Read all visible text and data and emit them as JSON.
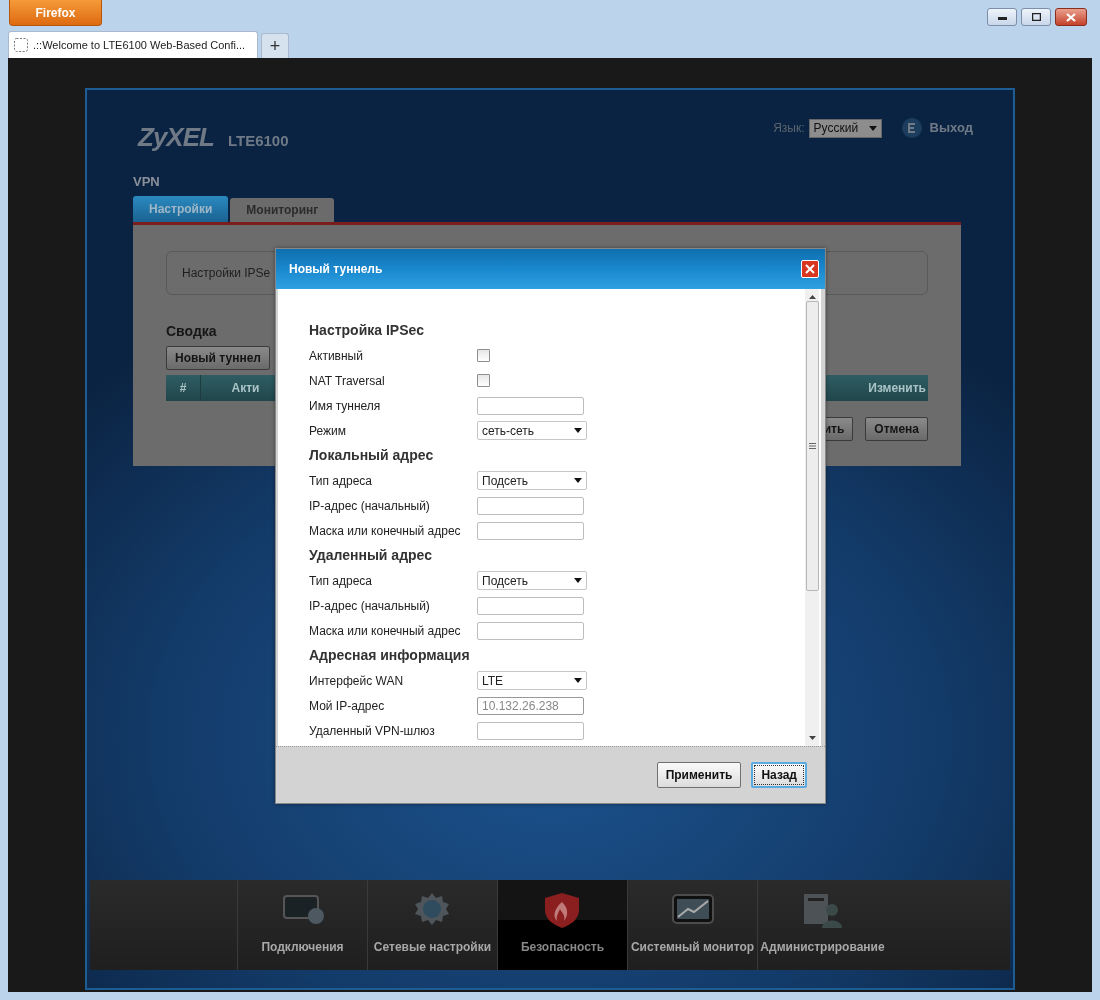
{
  "browser": {
    "menu_button": "Firefox",
    "tabs": [
      {
        "title": ".::Welcome to LTE6100 Web-Based Confi...",
        "selected": true
      }
    ],
    "new_tab": "+"
  },
  "header": {
    "logo": "ZyXEL",
    "model": "LTE6100",
    "language_label": "Язык:",
    "language": "Русский",
    "logout": "Выход"
  },
  "page_title": "VPN",
  "tabs": [
    {
      "label": "Настройки",
      "selected": true
    },
    {
      "label": "Мониторинг",
      "selected": false
    }
  ],
  "panel": {
    "info": "Настройки IPSe",
    "summary_title": "Сводка",
    "new_button": "Новый туннел",
    "table_columns": [
      "#",
      "Акти",
      "Изменить"
    ],
    "buttons": [
      "ить",
      "Отмена"
    ]
  },
  "dialog": {
    "title": "Новый туннель",
    "rows": [
      {
        "kind": "heading",
        "label": "Настройка IPSec"
      },
      {
        "kind": "checkbox",
        "label": "Активный",
        "checked": false
      },
      {
        "kind": "checkbox",
        "label": "NAT Traversal",
        "checked": false
      },
      {
        "kind": "text",
        "label": "Имя туннеля",
        "disabled": false
      },
      {
        "kind": "select",
        "label": "Режим",
        "value": "сеть-сеть"
      },
      {
        "kind": "heading",
        "label": "Локальный адрес"
      },
      {
        "kind": "select",
        "label": "Тип адреса",
        "value": "Подсеть"
      },
      {
        "kind": "text",
        "label": "IP-адрес (начальный)",
        "disabled": false
      },
      {
        "kind": "text",
        "label": "Маска или конечный адрес",
        "disabled": false
      },
      {
        "kind": "heading",
        "label": "Удаленный адрес"
      },
      {
        "kind": "select",
        "label": "Тип адреса",
        "value": "Подсеть"
      },
      {
        "kind": "text",
        "label": "IP-адрес (начальный)",
        "disabled": false
      },
      {
        "kind": "text",
        "label": "Маска или конечный адрес",
        "disabled": false
      },
      {
        "kind": "heading",
        "label": "Адресная информация"
      },
      {
        "kind": "select",
        "label": "Интерфейс WAN",
        "value": "LTE"
      },
      {
        "kind": "text",
        "label": "Мой IP-адрес",
        "value": "10.132.26.238",
        "disabled": true
      },
      {
        "kind": "text",
        "label": "Удаленный VPN-шлюз",
        "disabled": false
      }
    ],
    "buttons": [
      {
        "label": "Применить",
        "focused": false
      },
      {
        "label": "Назад",
        "focused": true
      }
    ]
  },
  "nav": [
    {
      "label": "Подключения",
      "selected": false
    },
    {
      "label": "Сетевые настройки",
      "selected": false
    },
    {
      "label": "Безопасность",
      "selected": true
    },
    {
      "label": "Системный монитор",
      "selected": false
    },
    {
      "label": "Администрирование",
      "selected": false
    }
  ]
}
